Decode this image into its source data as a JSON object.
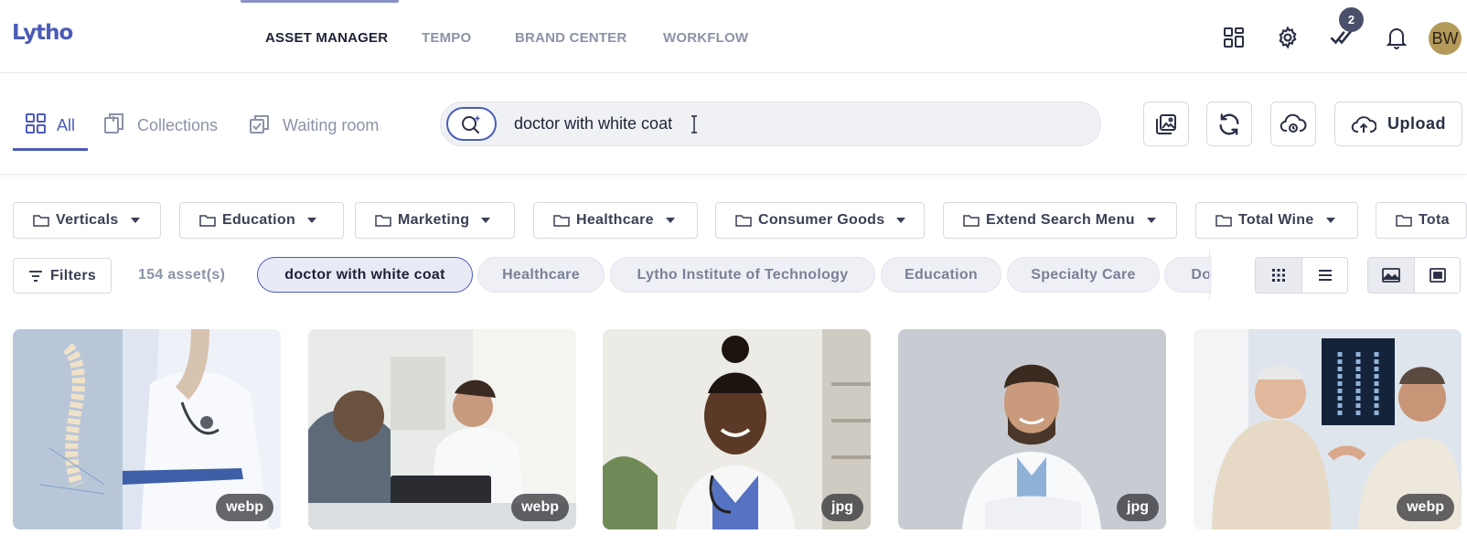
{
  "app": {
    "logo_text": "Lytho"
  },
  "nav": {
    "items": [
      {
        "label": "ASSET MANAGER",
        "active": true
      },
      {
        "label": "TEMPO",
        "active": false
      },
      {
        "label": "BRAND CENTER",
        "active": false
      },
      {
        "label": "WORKFLOW",
        "active": false
      }
    ],
    "icons": [
      "apps-grid-icon",
      "gear-icon",
      "tasks-check-icon",
      "bell-icon"
    ],
    "tasks_badge": "2",
    "avatar_initials": "BW"
  },
  "view_tabs": [
    {
      "label": "All",
      "icon": "grid-icon",
      "active": true
    },
    {
      "label": "Collections",
      "icon": "collections-icon",
      "active": false
    },
    {
      "label": "Waiting room",
      "icon": "waiting-room-icon",
      "active": false
    }
  ],
  "search": {
    "value": "doctor with white coat"
  },
  "toolbar": {
    "upload_label": "Upload"
  },
  "folders": [
    "Verticals",
    "Education",
    "Marketing",
    "Healthcare",
    "Consumer Goods",
    "Extend Search Menu",
    "Total Wine",
    "Tota"
  ],
  "filters": {
    "button_label": "Filters",
    "asset_count": "154 asset(s)",
    "tags": [
      {
        "label": "doctor with white coat",
        "selected": true
      },
      {
        "label": "Healthcare",
        "selected": false
      },
      {
        "label": "Lytho Institute of Technology",
        "selected": false
      },
      {
        "label": "Education",
        "selected": false
      },
      {
        "label": "Specialty Care",
        "selected": false
      },
      {
        "label": "Doc",
        "selected": false
      }
    ]
  },
  "assets": [
    {
      "format": "webp",
      "subject": "doctor holding spine model and clipboard"
    },
    {
      "format": "webp",
      "subject": "doctor consulting elderly patient with tablet"
    },
    {
      "format": "jpg",
      "subject": "smiling female doctor with stethoscope"
    },
    {
      "format": "jpg",
      "subject": "smiling male doctor arms crossed"
    },
    {
      "format": "webp",
      "subject": "doctor showing x-ray to senior patient"
    }
  ],
  "colors": {
    "accent": "#4b5bb8",
    "badge": "#4a5069",
    "avatar": "#b49a5a"
  }
}
